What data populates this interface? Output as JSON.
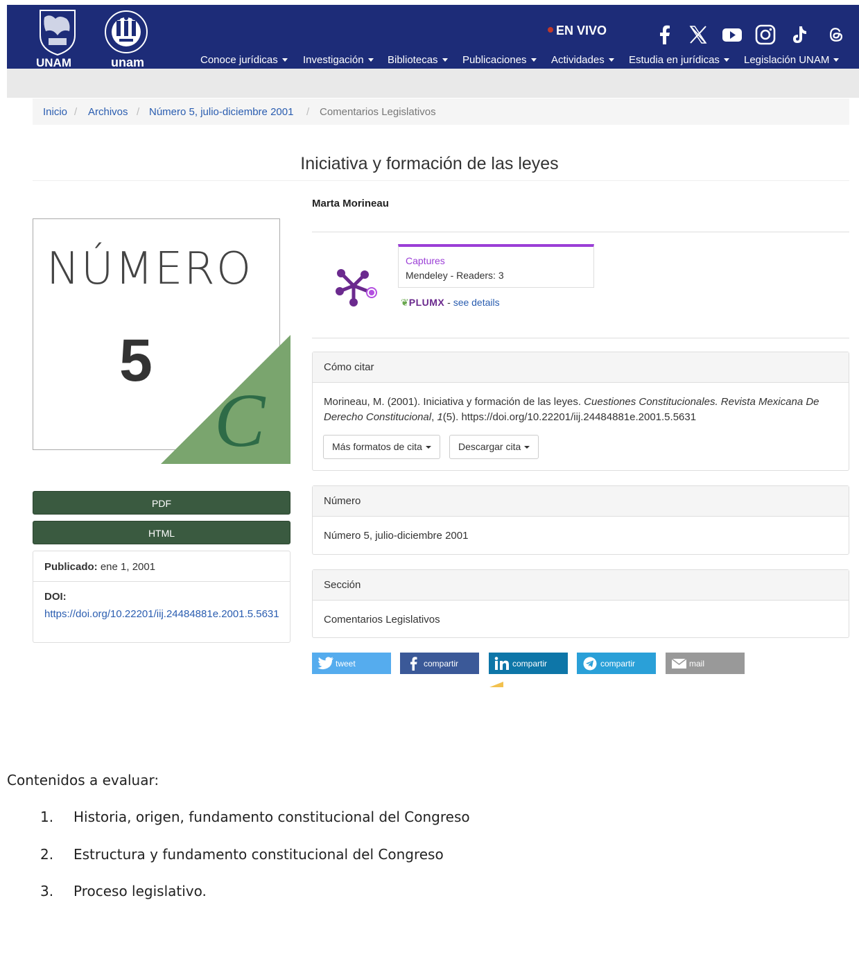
{
  "header": {
    "logo_unam": "UNAM",
    "logo_iij": "unam",
    "live_label": "EN VIVO",
    "nav": [
      "Conoce jurídicas",
      "Investigación",
      "Bibliotecas",
      "Publicaciones",
      "Actividades",
      "Estudia en jurídicas",
      "Legislación UNAM"
    ],
    "social_icons": [
      "facebook-icon",
      "x-icon",
      "youtube-icon",
      "instagram-icon",
      "tiktok-icon",
      "threads-icon"
    ]
  },
  "breadcrumb": [
    "Inicio",
    "Archivos",
    "Número 5, julio-diciembre 2001",
    "Comentarios Legislativos"
  ],
  "article": {
    "title": "Iniciativa y formación de las leyes",
    "author": "Marta Morineau"
  },
  "cover": {
    "word": "NÚMERO",
    "number": "5",
    "letter": "C",
    "colors": {
      "green": "#7aa56e",
      "dark_green": "#2e6b47"
    }
  },
  "galleys": {
    "pdf": "PDF",
    "html": "HTML"
  },
  "meta": {
    "published_label": "Publicado:",
    "published_value": "ene 1, 2001",
    "doi_label": "DOI:",
    "doi_value": "https://doi.org/10.22201/iij.24484881e.2001.5.5631"
  },
  "plumx": {
    "captures_label": "Captures",
    "readers": "Mendeley - Readers: 3",
    "brand": "PLUMX",
    "separator": " - ",
    "see_details": "see details",
    "accent": "#9b3fd6"
  },
  "citation": {
    "head": "Cómo citar",
    "text_plain1": "Morineau, M. (2001). Iniciativa y formación de las leyes. ",
    "text_italic1": "Cuestiones Constitucionales. Revista Mexicana De",
    "text_italic2": "Derecho Constitucional",
    "text_plain2": ", ",
    "text_italic3": "1",
    "text_plain3": "(5). https://doi.org/10.22201/iij.24484881e.2001.5.5631",
    "btn_formats": "Más formatos de cita",
    "btn_download": "Descargar cita"
  },
  "issue": {
    "head": "Número",
    "value": "Número 5, julio-diciembre 2001"
  },
  "section": {
    "head": "Sección",
    "value": "Comentarios Legislativos"
  },
  "share": [
    {
      "label": "tweet",
      "color": "#55acee"
    },
    {
      "label": "compartir",
      "color": "#3b5998"
    },
    {
      "label": "compartir",
      "color": "#0e76a8"
    },
    {
      "label": "compartir",
      "color": "#2aa0d8"
    },
    {
      "label": "mail",
      "color": "#999999"
    }
  ],
  "doc": {
    "heading": "Contenidos a evaluar:",
    "items": [
      {
        "n": "1.",
        "text": "Historia, origen, fundamento constitucional del Congreso"
      },
      {
        "n": "2.",
        "text": "Estructura y fundamento constitucional del Congreso"
      },
      {
        "n": "3.",
        "text": "Proceso legislativo."
      }
    ]
  }
}
